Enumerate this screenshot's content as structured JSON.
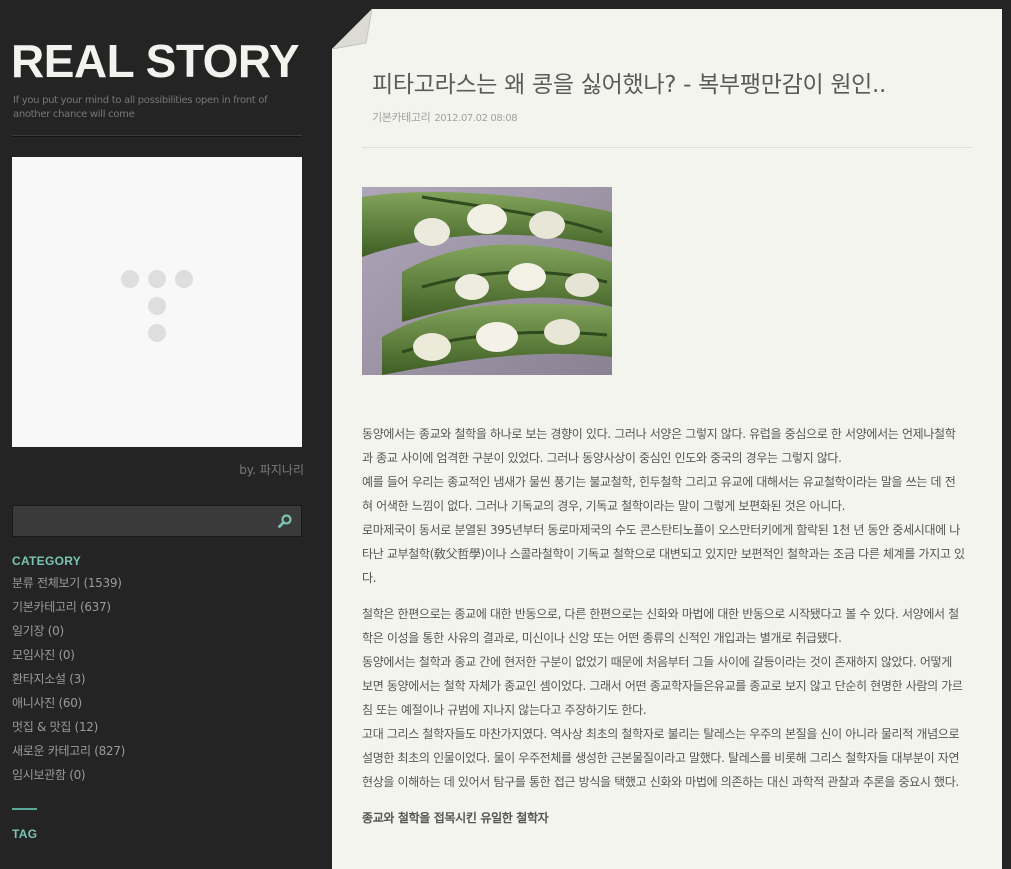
{
  "blog": {
    "title": "REAL STORY",
    "description": "If you put your mind to all possibilities open in front of another chance will come"
  },
  "profile": {
    "byline": "by. 파지나리"
  },
  "search": {
    "placeholder": "",
    "icon": "search-icon"
  },
  "category": {
    "heading": "CATEGORY",
    "items": [
      {
        "label": "분류 전체보기 (1539)"
      },
      {
        "label": "기본카테고리 (637)"
      },
      {
        "label": "일기장 (0)"
      },
      {
        "label": "모임사진 (0)"
      },
      {
        "label": "환타지소설 (3)"
      },
      {
        "label": "애니사진 (60)"
      },
      {
        "label": "멋집 & 맛집 (12)"
      },
      {
        "label": "새로운 카테고리 (827)"
      },
      {
        "label": "임시보관함 (0)"
      }
    ]
  },
  "tag": {
    "heading": "TAG"
  },
  "post": {
    "title": "피타고라스는 왜 콩을 싫어했나? - 복부팽만감이 원인..",
    "category": "기본카테고리",
    "date": "2012.07.02 08:08",
    "paragraphs": [
      "동양에서는 종교와 철학을 하나로 보는 경향이 있다. 그러나 서양은 그렇지 않다. 유럽을 중심으로 한 서양에서는 언제나철학과 종교 사이에 엄격한 구분이 있었다. 그러나 동양사상이 중심인 인도와 중국의 경우는 그렇지 않다.",
      "예를 들어 우리는 종교적인 냄새가 물씬 풍기는 불교철학, 힌두철학 그리고 유교에 대해서는 유교철학이라는 말을 쓰는 데 전혀 어색한 느낌이 없다. 그러나 기독교의 경우, 기독교 철학이라는 말이 그렇게 보편화된 것은 아니다.",
      "로마제국이 동서로 분열된 395년부터 동로마제국의 수도 콘스탄티노플이 오스만터키에게 함락된 1천 년 동안 중세시대에 나타난 교부철학(敎父哲學)이나 스콜라철학이 기독교 철학으로 대변되고 있지만 보편적인 철학과는 조금 다른 체계를 가지고 있다.",
      "철학은 한편으로는 종교에 대한 반동으로, 다른 한편으로는 신화와 마법에 대한 반동으로 시작됐다고 볼 수 있다. 서양에서 철학은 이성을 통한 사유의 결과로, 미신이나 신앙 또는 어떤 종류의 신적인 개입과는 별개로 취급됐다.",
      "동양에서는 철학과 종교 간에 현저한 구분이 없었기 때문에 처음부터 그들 사이에 갈등이라는 것이 존재하지 않았다. 어떻게 보면 동양에서는 철학 자체가 종교인 셈이었다. 그래서 어떤 종교학자들은유교를 종교로 보지 않고 단순히 현명한 사람의 가르침 또는 예절이나 규범에 지나지 않는다고 주장하기도 한다.",
      "고대 그리스 철학자들도 마찬가지였다. 역사상 최초의 철학자로 불리는 탈레스는 우주의 본질을 신이 아니라 물리적 개념으로 설명한 최초의 인물이었다. 물이 우주전체를 생성한 근본물질이라고 말했다. 탈레스를 비롯해 그리스 철학자들 대부분이 자연현상을 이해하는 데 있어서 탐구를 통한 접근 방식을 택했고 신화와 마법에 의존하는 대신 과학적 관찰과 추론을 중요시 했다."
    ],
    "subheading": "종교와 철학을 접목시킨 유일한 철학자"
  },
  "colors": {
    "sidebar_bg": "#242424",
    "accent": "#7bc4b2",
    "content_bg": "#f4f4ef"
  }
}
